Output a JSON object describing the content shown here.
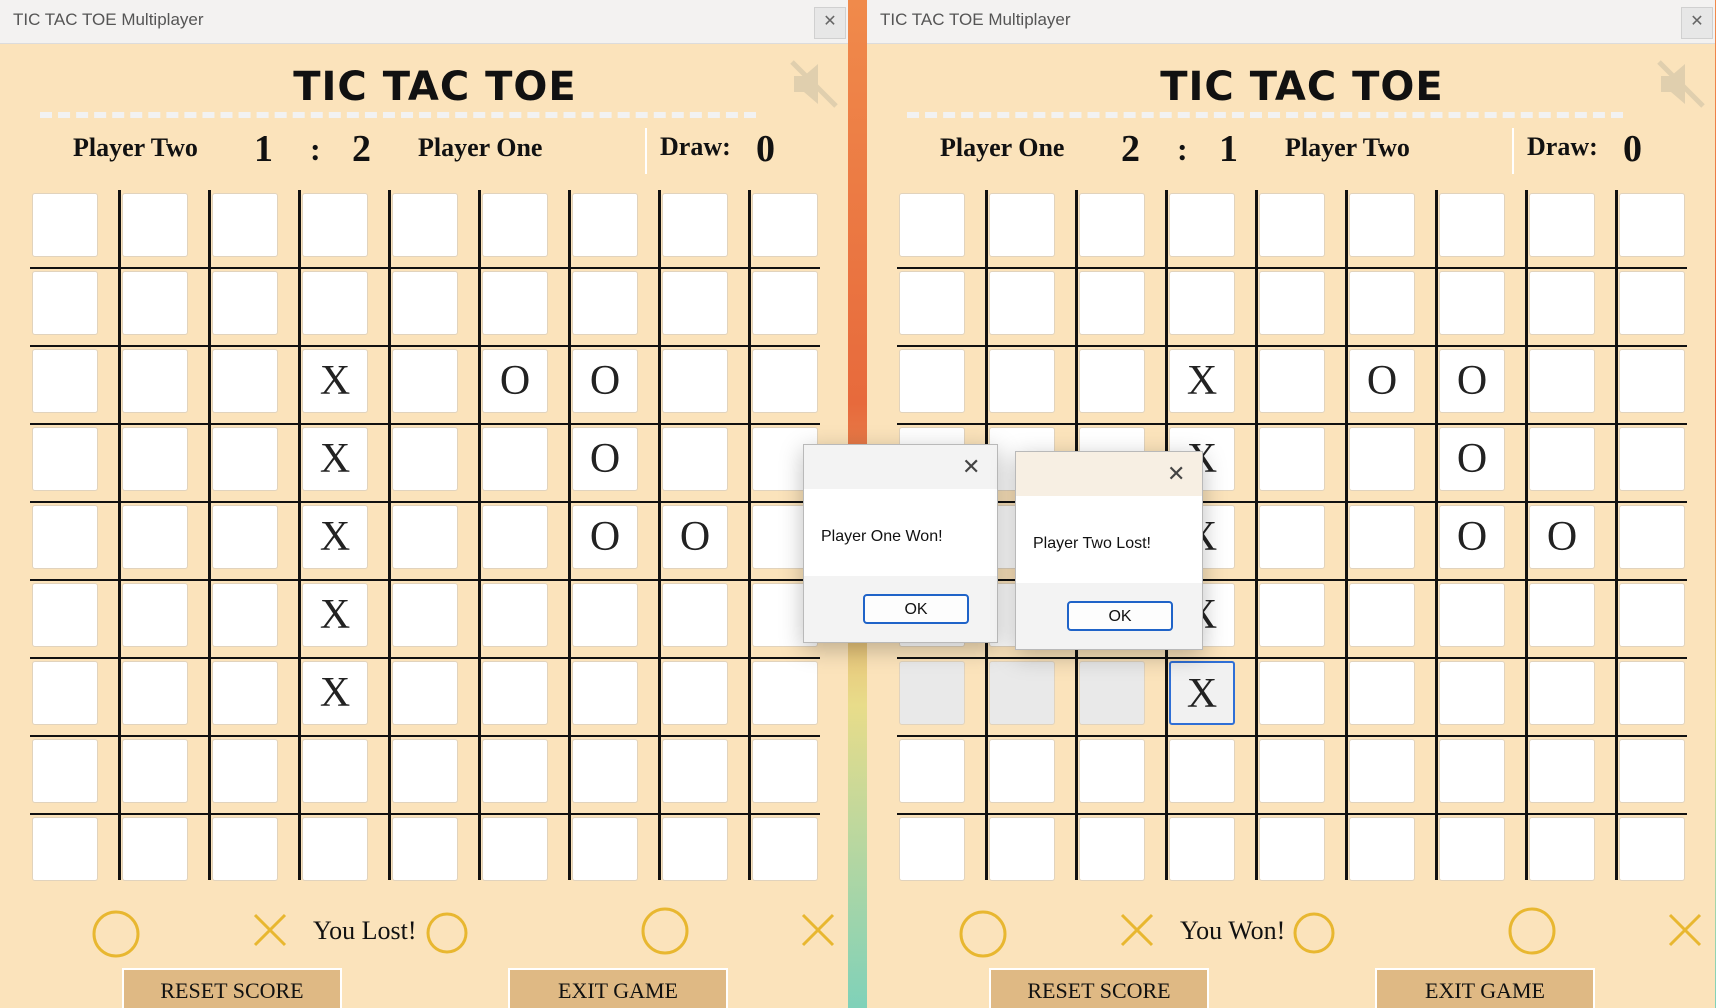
{
  "windows": {
    "left": {
      "title": "TIC TAC TOE Multiplayer",
      "game_title": "TIC TAC TOE",
      "score": {
        "left_player": "Player Two",
        "left_score": "1",
        "colon": ":",
        "right_score": "2",
        "right_player": "Player One",
        "draw_label": "Draw:",
        "draw_value": "0"
      },
      "status": "You Lost!",
      "reset_label": "RESET SCORE",
      "exit_label": "EXIT GAME",
      "close_glyph": "✕",
      "mute_icon": "speaker-muted-icon",
      "board": [
        [
          "",
          "",
          "",
          "",
          "",
          "",
          "",
          "",
          ""
        ],
        [
          "",
          "",
          "",
          "",
          "",
          "",
          "",
          "",
          ""
        ],
        [
          "",
          "",
          "",
          "X",
          "",
          "O",
          "O",
          "",
          ""
        ],
        [
          "",
          "",
          "",
          "X",
          "",
          "",
          "O",
          "",
          ""
        ],
        [
          "",
          "",
          "",
          "X",
          "",
          "",
          "O",
          "O",
          ""
        ],
        [
          "",
          "",
          "",
          "X",
          "",
          "",
          "",
          "",
          ""
        ],
        [
          "",
          "",
          "",
          "X",
          "",
          "",
          "",
          "",
          ""
        ],
        [
          "",
          "",
          "",
          "",
          "",
          "",
          "",
          "",
          ""
        ],
        [
          "",
          "",
          "",
          "",
          "",
          "",
          "",
          "",
          ""
        ]
      ]
    },
    "right": {
      "title": "TIC TAC TOE Multiplayer",
      "game_title": "TIC TAC TOE",
      "score": {
        "left_player": "Player One",
        "left_score": "2",
        "colon": ":",
        "right_score": "1",
        "right_player": "Player Two",
        "draw_label": "Draw:",
        "draw_value": "0"
      },
      "status": "You Won!",
      "reset_label": "RESET SCORE",
      "exit_label": "EXIT GAME",
      "close_glyph": "✕",
      "mute_icon": "speaker-muted-icon",
      "board": [
        [
          "",
          "",
          "",
          "",
          "",
          "",
          "",
          "",
          ""
        ],
        [
          "",
          "",
          "",
          "",
          "",
          "",
          "",
          "",
          ""
        ],
        [
          "",
          "",
          "",
          "X",
          "",
          "O",
          "O",
          "",
          ""
        ],
        [
          "",
          "",
          "",
          "X",
          "",
          "",
          "O",
          "",
          ""
        ],
        [
          "",
          "",
          "",
          "X",
          "",
          "",
          "O",
          "O",
          ""
        ],
        [
          "",
          "",
          "",
          "X",
          "",
          "",
          "",
          "",
          ""
        ],
        [
          "",
          "",
          "",
          "X",
          "",
          "",
          "",
          "",
          ""
        ],
        [
          "",
          "",
          "",
          "",
          "",
          "",
          "",
          "",
          ""
        ],
        [
          "",
          "",
          "",
          "",
          "",
          "",
          "",
          "",
          ""
        ]
      ]
    }
  },
  "dialogs": {
    "won": {
      "message": "Player One Won!",
      "ok_label": "OK",
      "close_glyph": "✕"
    },
    "lost": {
      "message": "Player Two Lost!",
      "ok_label": "OK",
      "close_glyph": "✕"
    }
  },
  "colors": {
    "game_bg": "#fbe3bb",
    "button_bg": "#dfb984",
    "deco_gold": "#e8b730",
    "ok_border": "#1f63c8"
  }
}
